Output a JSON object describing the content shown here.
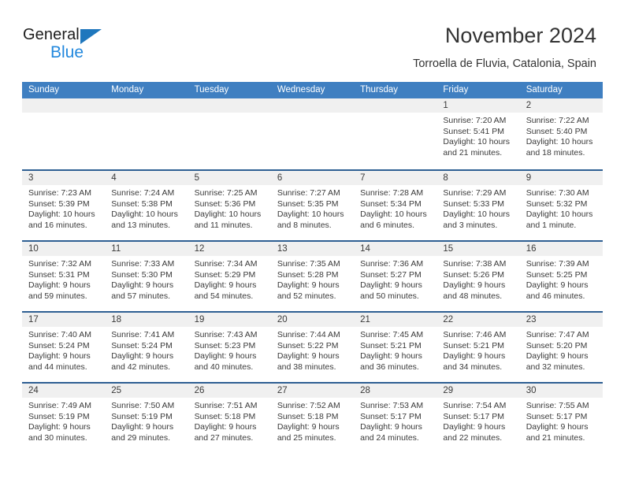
{
  "brand": {
    "name_part1": "General",
    "name_part2": "Blue",
    "accent_color": "#2288dd",
    "triangle_color": "#1f77bd"
  },
  "header": {
    "title": "November 2024",
    "subtitle": "Torroella de Fluvia, Catalonia, Spain"
  },
  "calendar": {
    "header_bg": "#3f7fc1",
    "row_border_color": "#2e5f93",
    "daynum_bg": "#f0f0f0",
    "weekdays": [
      "Sunday",
      "Monday",
      "Tuesday",
      "Wednesday",
      "Thursday",
      "Friday",
      "Saturday"
    ],
    "weeks": [
      [
        {
          "empty": true
        },
        {
          "empty": true
        },
        {
          "empty": true
        },
        {
          "empty": true
        },
        {
          "empty": true
        },
        {
          "day": "1",
          "sunrise": "Sunrise: 7:20 AM",
          "sunset": "Sunset: 5:41 PM",
          "daylight1": "Daylight: 10 hours",
          "daylight2": "and 21 minutes."
        },
        {
          "day": "2",
          "sunrise": "Sunrise: 7:22 AM",
          "sunset": "Sunset: 5:40 PM",
          "daylight1": "Daylight: 10 hours",
          "daylight2": "and 18 minutes."
        }
      ],
      [
        {
          "day": "3",
          "sunrise": "Sunrise: 7:23 AM",
          "sunset": "Sunset: 5:39 PM",
          "daylight1": "Daylight: 10 hours",
          "daylight2": "and 16 minutes."
        },
        {
          "day": "4",
          "sunrise": "Sunrise: 7:24 AM",
          "sunset": "Sunset: 5:38 PM",
          "daylight1": "Daylight: 10 hours",
          "daylight2": "and 13 minutes."
        },
        {
          "day": "5",
          "sunrise": "Sunrise: 7:25 AM",
          "sunset": "Sunset: 5:36 PM",
          "daylight1": "Daylight: 10 hours",
          "daylight2": "and 11 minutes."
        },
        {
          "day": "6",
          "sunrise": "Sunrise: 7:27 AM",
          "sunset": "Sunset: 5:35 PM",
          "daylight1": "Daylight: 10 hours",
          "daylight2": "and 8 minutes."
        },
        {
          "day": "7",
          "sunrise": "Sunrise: 7:28 AM",
          "sunset": "Sunset: 5:34 PM",
          "daylight1": "Daylight: 10 hours",
          "daylight2": "and 6 minutes."
        },
        {
          "day": "8",
          "sunrise": "Sunrise: 7:29 AM",
          "sunset": "Sunset: 5:33 PM",
          "daylight1": "Daylight: 10 hours",
          "daylight2": "and 3 minutes."
        },
        {
          "day": "9",
          "sunrise": "Sunrise: 7:30 AM",
          "sunset": "Sunset: 5:32 PM",
          "daylight1": "Daylight: 10 hours",
          "daylight2": "and 1 minute."
        }
      ],
      [
        {
          "day": "10",
          "sunrise": "Sunrise: 7:32 AM",
          "sunset": "Sunset: 5:31 PM",
          "daylight1": "Daylight: 9 hours",
          "daylight2": "and 59 minutes."
        },
        {
          "day": "11",
          "sunrise": "Sunrise: 7:33 AM",
          "sunset": "Sunset: 5:30 PM",
          "daylight1": "Daylight: 9 hours",
          "daylight2": "and 57 minutes."
        },
        {
          "day": "12",
          "sunrise": "Sunrise: 7:34 AM",
          "sunset": "Sunset: 5:29 PM",
          "daylight1": "Daylight: 9 hours",
          "daylight2": "and 54 minutes."
        },
        {
          "day": "13",
          "sunrise": "Sunrise: 7:35 AM",
          "sunset": "Sunset: 5:28 PM",
          "daylight1": "Daylight: 9 hours",
          "daylight2": "and 52 minutes."
        },
        {
          "day": "14",
          "sunrise": "Sunrise: 7:36 AM",
          "sunset": "Sunset: 5:27 PM",
          "daylight1": "Daylight: 9 hours",
          "daylight2": "and 50 minutes."
        },
        {
          "day": "15",
          "sunrise": "Sunrise: 7:38 AM",
          "sunset": "Sunset: 5:26 PM",
          "daylight1": "Daylight: 9 hours",
          "daylight2": "and 48 minutes."
        },
        {
          "day": "16",
          "sunrise": "Sunrise: 7:39 AM",
          "sunset": "Sunset: 5:25 PM",
          "daylight1": "Daylight: 9 hours",
          "daylight2": "and 46 minutes."
        }
      ],
      [
        {
          "day": "17",
          "sunrise": "Sunrise: 7:40 AM",
          "sunset": "Sunset: 5:24 PM",
          "daylight1": "Daylight: 9 hours",
          "daylight2": "and 44 minutes."
        },
        {
          "day": "18",
          "sunrise": "Sunrise: 7:41 AM",
          "sunset": "Sunset: 5:24 PM",
          "daylight1": "Daylight: 9 hours",
          "daylight2": "and 42 minutes."
        },
        {
          "day": "19",
          "sunrise": "Sunrise: 7:43 AM",
          "sunset": "Sunset: 5:23 PM",
          "daylight1": "Daylight: 9 hours",
          "daylight2": "and 40 minutes."
        },
        {
          "day": "20",
          "sunrise": "Sunrise: 7:44 AM",
          "sunset": "Sunset: 5:22 PM",
          "daylight1": "Daylight: 9 hours",
          "daylight2": "and 38 minutes."
        },
        {
          "day": "21",
          "sunrise": "Sunrise: 7:45 AM",
          "sunset": "Sunset: 5:21 PM",
          "daylight1": "Daylight: 9 hours",
          "daylight2": "and 36 minutes."
        },
        {
          "day": "22",
          "sunrise": "Sunrise: 7:46 AM",
          "sunset": "Sunset: 5:21 PM",
          "daylight1": "Daylight: 9 hours",
          "daylight2": "and 34 minutes."
        },
        {
          "day": "23",
          "sunrise": "Sunrise: 7:47 AM",
          "sunset": "Sunset: 5:20 PM",
          "daylight1": "Daylight: 9 hours",
          "daylight2": "and 32 minutes."
        }
      ],
      [
        {
          "day": "24",
          "sunrise": "Sunrise: 7:49 AM",
          "sunset": "Sunset: 5:19 PM",
          "daylight1": "Daylight: 9 hours",
          "daylight2": "and 30 minutes."
        },
        {
          "day": "25",
          "sunrise": "Sunrise: 7:50 AM",
          "sunset": "Sunset: 5:19 PM",
          "daylight1": "Daylight: 9 hours",
          "daylight2": "and 29 minutes."
        },
        {
          "day": "26",
          "sunrise": "Sunrise: 7:51 AM",
          "sunset": "Sunset: 5:18 PM",
          "daylight1": "Daylight: 9 hours",
          "daylight2": "and 27 minutes."
        },
        {
          "day": "27",
          "sunrise": "Sunrise: 7:52 AM",
          "sunset": "Sunset: 5:18 PM",
          "daylight1": "Daylight: 9 hours",
          "daylight2": "and 25 minutes."
        },
        {
          "day": "28",
          "sunrise": "Sunrise: 7:53 AM",
          "sunset": "Sunset: 5:17 PM",
          "daylight1": "Daylight: 9 hours",
          "daylight2": "and 24 minutes."
        },
        {
          "day": "29",
          "sunrise": "Sunrise: 7:54 AM",
          "sunset": "Sunset: 5:17 PM",
          "daylight1": "Daylight: 9 hours",
          "daylight2": "and 22 minutes."
        },
        {
          "day": "30",
          "sunrise": "Sunrise: 7:55 AM",
          "sunset": "Sunset: 5:17 PM",
          "daylight1": "Daylight: 9 hours",
          "daylight2": "and 21 minutes."
        }
      ]
    ]
  }
}
